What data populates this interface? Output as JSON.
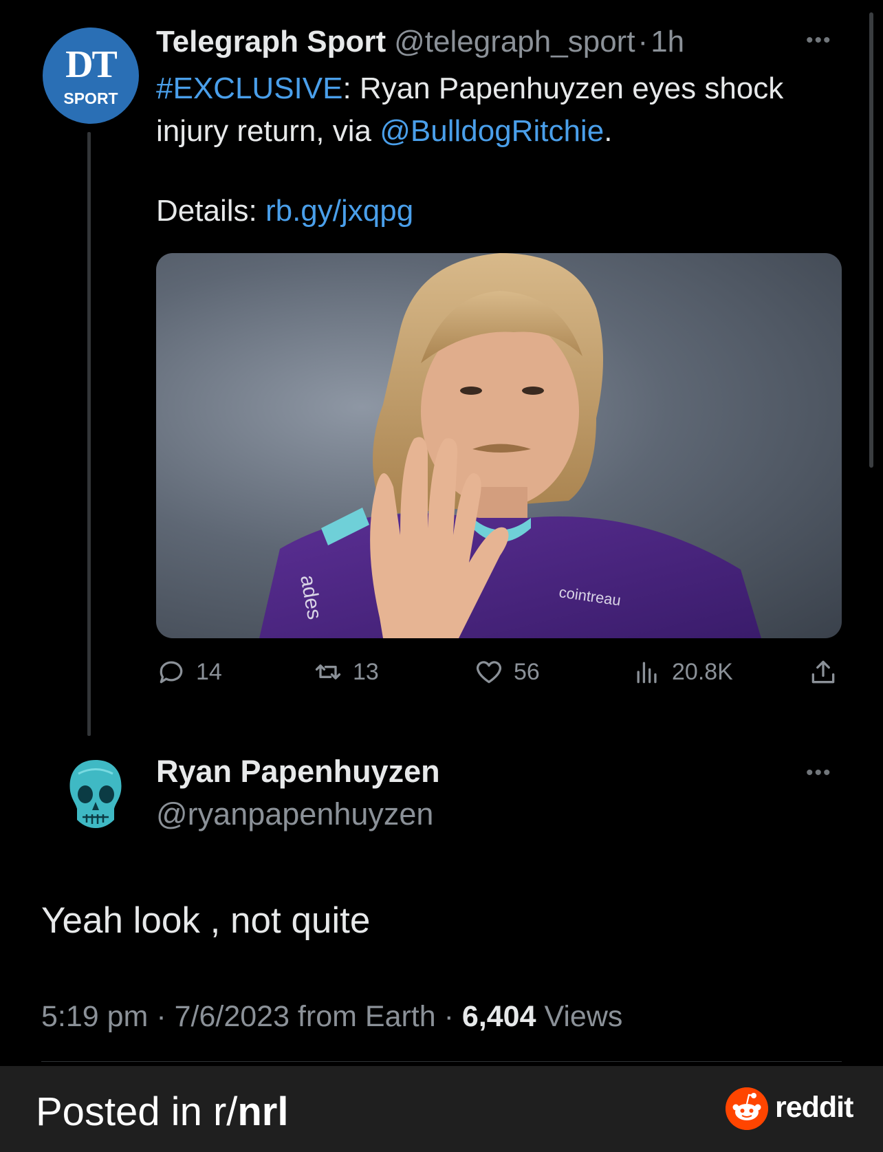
{
  "quoted_tweet": {
    "avatar": {
      "line1": "DT",
      "line2": "SPORT"
    },
    "display_name": "Telegraph Sport",
    "handle": "@telegraph_sport",
    "separator": "·",
    "time": "1h",
    "more_icon": "more-dots-icon",
    "body": {
      "hashtag": "#EXCLUSIVE",
      "text_part1": ": Ryan Papenhuyzen eyes shock injury return, via ",
      "mention": "@BulldogRitchie",
      "text_part2": ".",
      "details_label": "Details: ",
      "details_link": "rb.gy/jxqpg"
    },
    "media": {
      "jersey_text_1": "cointreau",
      "jersey_text_2": "ades"
    },
    "stats": {
      "replies": "14",
      "retweets": "13",
      "likes": "56",
      "views": "20.8K"
    }
  },
  "reply_tweet": {
    "display_name": "Ryan Papenhuyzen",
    "handle": "@ryanpapenhuyzen",
    "text": "Yeah look , not quite",
    "time": "5:19 pm",
    "date": "7/6/2023 from Earth",
    "separator": "·",
    "views_count": "6,404",
    "views_label": "Views"
  },
  "footer": {
    "posted_prefix": "Posted in r/",
    "subreddit": "nrl",
    "brand": "reddit"
  },
  "colors": {
    "background": "#000000",
    "link": "#4a9fea",
    "secondary_text": "#8b9198",
    "footer_bg": "#1f1f1f",
    "reddit_orange": "#ff4500",
    "dt_blue": "#2a6fb5"
  }
}
